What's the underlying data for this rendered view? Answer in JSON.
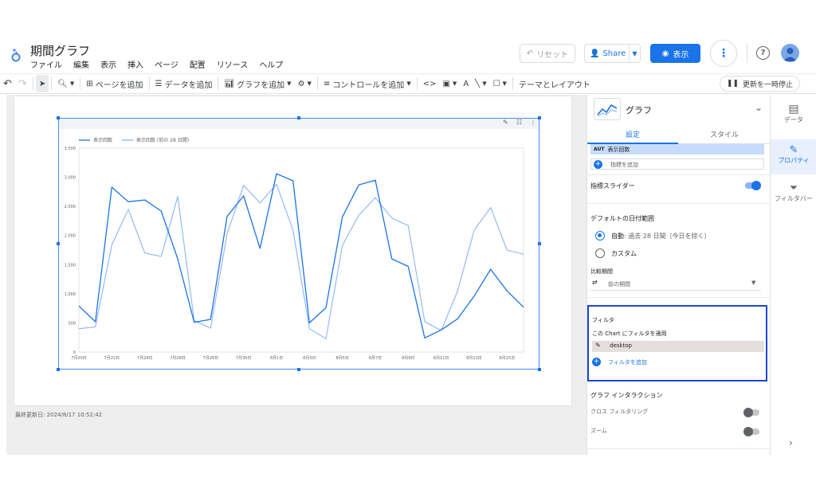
{
  "app": {
    "title": "期間グラフ",
    "menu": [
      "ファイル",
      "編集",
      "表示",
      "挿入",
      "ページ",
      "配置",
      "リソース",
      "ヘルプ"
    ],
    "reset_label": "リセット",
    "share_label": "Share",
    "view_label": "表示"
  },
  "toolbar": {
    "add_page": "ページを追加",
    "add_data": "データを追加",
    "add_chart": "グラフを追加",
    "add_control": "コントロールを追加",
    "theme_layout": "テーマとレイアウト",
    "pause_updates": "更新を一時停止"
  },
  "canvas": {
    "last_updated": "最終更新日: 2024/8/17 10:52:42"
  },
  "chart_data": {
    "type": "line",
    "title": "",
    "xlabel": "",
    "ylabel": "",
    "ylim": [
      0,
      3500
    ],
    "yticks": [
      "0",
      "500",
      "1,000",
      "1,500",
      "2,000",
      "2,500",
      "3,000",
      "3,500"
    ],
    "xticks": [
      "7月20日",
      "7月22日",
      "7月24日",
      "7月26日",
      "7月28日",
      "7月30日",
      "8月1日",
      "8月3日",
      "8月5日",
      "8月7日",
      "8月9日",
      "8月11日",
      "8月13日",
      "8月15日"
    ],
    "x": [
      "7月20日",
      "7月21日",
      "7月22日",
      "7月23日",
      "7月24日",
      "7月25日",
      "7月26日",
      "7月27日",
      "7月28日",
      "7月29日",
      "7月30日",
      "7月31日",
      "8月1日",
      "8月2日",
      "8月3日",
      "8月4日",
      "8月5日",
      "8月6日",
      "8月7日",
      "8月8日",
      "8月9日",
      "8月10日",
      "8月11日",
      "8月12日",
      "8月13日",
      "8月14日",
      "8月15日",
      "8月16日"
    ],
    "series": [
      {
        "name": "表示回数",
        "color": "#1a73e8",
        "values": [
          790,
          520,
          2830,
          2580,
          2610,
          2420,
          1600,
          510,
          560,
          2330,
          2680,
          1780,
          3060,
          2940,
          500,
          760,
          2320,
          2870,
          2950,
          1600,
          1470,
          240,
          380,
          570,
          960,
          1420,
          1050,
          770
        ]
      },
      {
        "name": "表示回数 (前の 28 日間)",
        "color": "#8ab4f8",
        "values": [
          400,
          430,
          1840,
          2450,
          1700,
          1640,
          2670,
          540,
          410,
          2030,
          2860,
          2560,
          2880,
          2090,
          400,
          230,
          1830,
          2350,
          2650,
          2300,
          2170,
          520,
          370,
          1050,
          2090,
          2480,
          1750,
          1680
        ]
      }
    ],
    "legend_position": "top-left",
    "grid": false
  },
  "panel": {
    "chart_type": "グラフ",
    "tabs": [
      "設定",
      "スタイル"
    ],
    "metric_badge": "AUT",
    "metric_name": "表示回数",
    "add_metric": "指標を追加",
    "metric_slider": "指標スライダー",
    "date_range_title": "デフォルトの日付範囲",
    "auto_label": "自動",
    "auto_desc": ": 過去 28 日間（今日を除く）",
    "custom_label": "カスタム",
    "comparison_title": "比較期間",
    "comparison_value": "前の期間",
    "filter_title": "フィルタ",
    "filter_subtitle": "この Chart にフィルタを適用",
    "filter_item": "desktop",
    "add_filter": "フィルタを追加",
    "interaction_title": "グラフ インタラクション",
    "cross_filter": "クロス フィルタリング",
    "zoom": "ズーム"
  },
  "rail": {
    "data": "データ",
    "properties": "プロパティ",
    "filter_bar": "フィルタバー"
  },
  "colors": {
    "accent": "#1a73e8",
    "highlight_border": "#1a47d6"
  }
}
